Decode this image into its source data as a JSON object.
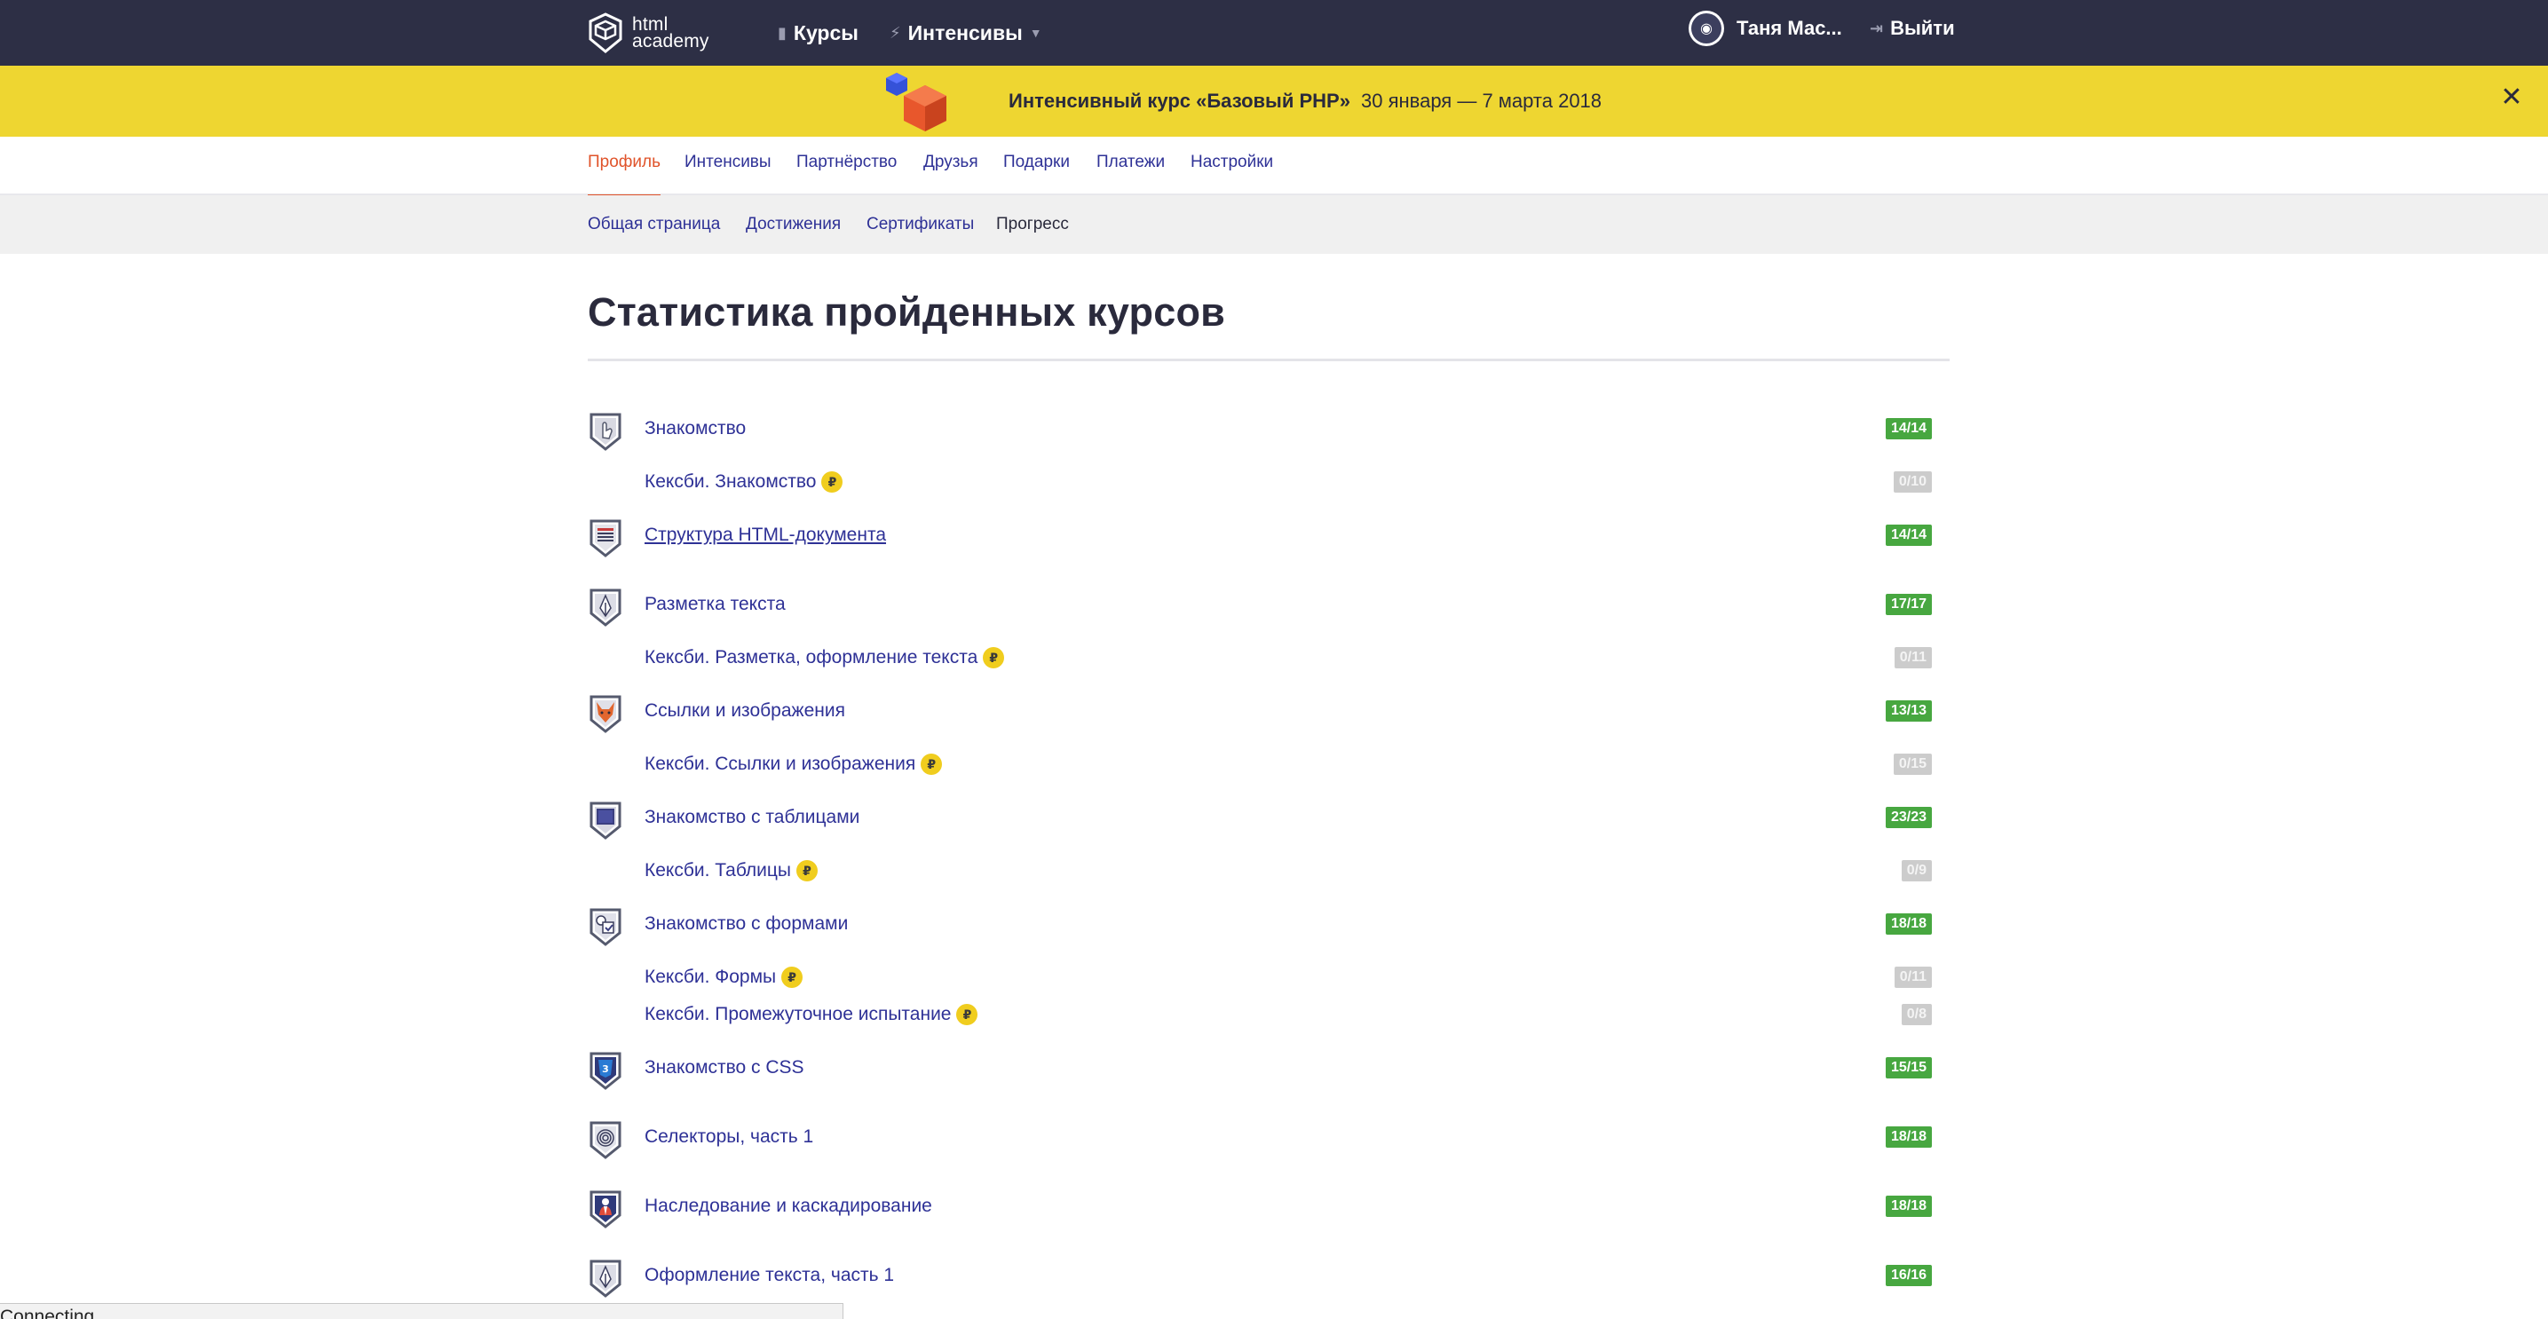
{
  "header": {
    "logo_line1": "html",
    "logo_line2": "academy",
    "nav_courses": "Курсы",
    "nav_intensives": "Интенсивы",
    "user_name": "Таня Мас...",
    "logout": "Выйти"
  },
  "promo": {
    "title": "Интенсивный курс «Базовый PHP»",
    "dates": "30 января — 7 марта 2018",
    "close_glyph": "✕"
  },
  "tabs": [
    "Профиль",
    "Интенсивы",
    "Партнёрство",
    "Друзья",
    "Подарки",
    "Платежи",
    "Настройки"
  ],
  "subtabs": [
    "Общая страница",
    "Достижения",
    "Сертификаты",
    "Прогресс"
  ],
  "page_title": "Статистика пройденных курсов",
  "courses": [
    {
      "title": "Знакомство",
      "progress": "14/14",
      "paid": false,
      "icon": "hand-badge-icon"
    },
    {
      "title": "Кексби. Знакомство",
      "progress": "0/10",
      "paid": true
    },
    {
      "title": "Структура HTML-документа",
      "progress": "14/14",
      "paid": false,
      "icon": "document-badge-icon"
    },
    {
      "title": "Разметка текста",
      "progress": "17/17",
      "paid": false,
      "icon": "pen-badge-icon"
    },
    {
      "title": "Кексби. Разметка, оформление текста",
      "progress": "0/11",
      "paid": true
    },
    {
      "title": "Ссылки и изображения",
      "progress": "13/13",
      "paid": false,
      "icon": "fox-badge-icon"
    },
    {
      "title": "Кексби. Ссылки и изображения",
      "progress": "0/15",
      "paid": true
    },
    {
      "title": "Знакомство с таблицами",
      "progress": "23/23",
      "paid": false,
      "icon": "table-badge-icon"
    },
    {
      "title": "Кексби. Таблицы",
      "progress": "0/9",
      "paid": true
    },
    {
      "title": "Знакомство с формами",
      "progress": "18/18",
      "paid": false,
      "icon": "forms-badge-icon"
    },
    {
      "title": "Кексби. Формы",
      "progress": "0/11",
      "paid": true
    },
    {
      "title": "Кексби. Промежуточное испытание",
      "progress": "0/8",
      "paid": true
    },
    {
      "title": "Знакомство с CSS",
      "progress": "15/15",
      "paid": false,
      "icon": "css-badge-icon"
    },
    {
      "title": "Селекторы, часть 1",
      "progress": "18/18",
      "paid": false,
      "icon": "target-badge-icon"
    },
    {
      "title": "Наследование и каскадирование",
      "progress": "18/18",
      "paid": false,
      "icon": "person-badge-icon"
    },
    {
      "title": "Оформление текста, часть 1",
      "progress": "16/16",
      "paid": false,
      "icon": "pen-badge-icon"
    }
  ],
  "rub_glyph": "₽",
  "status_text": "Connecting...",
  "colors": {
    "header_bg": "#2d2f45",
    "promo_bg": "#eed631",
    "link": "#2e3196",
    "active_tab": "#e0532a",
    "done_badge": "#47a740",
    "empty_badge": "#cccccc",
    "rub_badge": "#f0cd1e"
  }
}
